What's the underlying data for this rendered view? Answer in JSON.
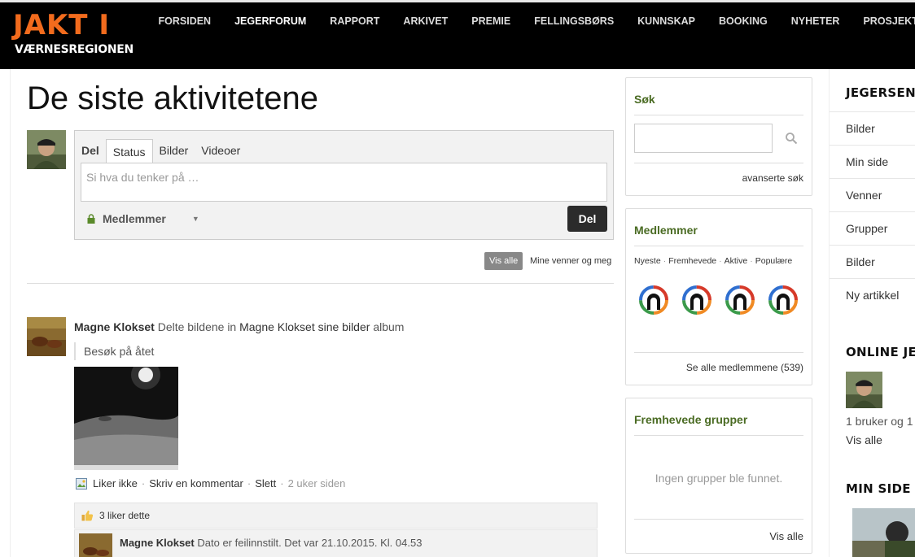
{
  "header": {
    "logo_main": "JAKT I",
    "logo_sub": "VÆRNESREGIONEN",
    "nav": [
      "FORSIDEN",
      "JEGERFORUM",
      "RAPPORT",
      "ARKIVET",
      "PREMIE",
      "FELLINGSBØRS",
      "KUNNSKAP",
      "BOOKING",
      "NYHETER",
      "PROSJEKTET"
    ],
    "active_nav": "JEGERFORUM"
  },
  "main": {
    "title": "De siste aktivitetene",
    "composer": {
      "tab_label": "Del",
      "tabs": [
        "Status",
        "Bilder",
        "Videoer"
      ],
      "placeholder": "Si hva du tenker på …",
      "privacy": "Medlemmer",
      "share_button": "Del"
    },
    "filters": {
      "all": "Vis alle",
      "friends": "Mine venner og meg"
    },
    "activity": {
      "user": "Magne Klokset",
      "verb": "Delte bildene in",
      "target": "Magne Klokset sine bilder",
      "suffix": "album",
      "quote": "Besøk på åtet",
      "actions": {
        "unlike": "Liker ikke",
        "comment": "Skriv en kommentar",
        "delete": "Slett",
        "time": "2 uker siden"
      },
      "likes": "3 liker dette",
      "comment": {
        "user": "Magne Klokset",
        "text": "Dato er feilinnstilt. Det var 21.10.2015. Kl. 04.53"
      }
    }
  },
  "sidebar": {
    "search": {
      "title": "Søk",
      "advanced": "avanserte søk"
    },
    "members": {
      "title": "Medlemmer",
      "tabs": [
        "Nyeste",
        "Fremhevede",
        "Aktive",
        "Populære"
      ],
      "see_all": "Se alle medlemmene (539)"
    },
    "groups": {
      "title": "Fremhevede grupper",
      "empty": "Ingen grupper ble funnet.",
      "see_all": "Vis alle"
    }
  },
  "right": {
    "heading_center": "JEGERSENT",
    "items": [
      "Bilder",
      "Min side",
      "Venner",
      "Grupper",
      "Bilder",
      "Ny artikkel"
    ],
    "heading_online": "ONLINE JEG",
    "online_text": "1 bruker og 1",
    "online_all": "Vis alle",
    "heading_minside": "MIN SIDE"
  },
  "colors": {
    "brand_orange": "#f26b1d",
    "widget_title_green": "#4a6b23",
    "header_bg": "#000000"
  },
  "icons": [
    "lock-icon",
    "search-icon",
    "like-icon",
    "thumbs-up-icon",
    "caret-down-icon",
    "image-icon"
  ]
}
